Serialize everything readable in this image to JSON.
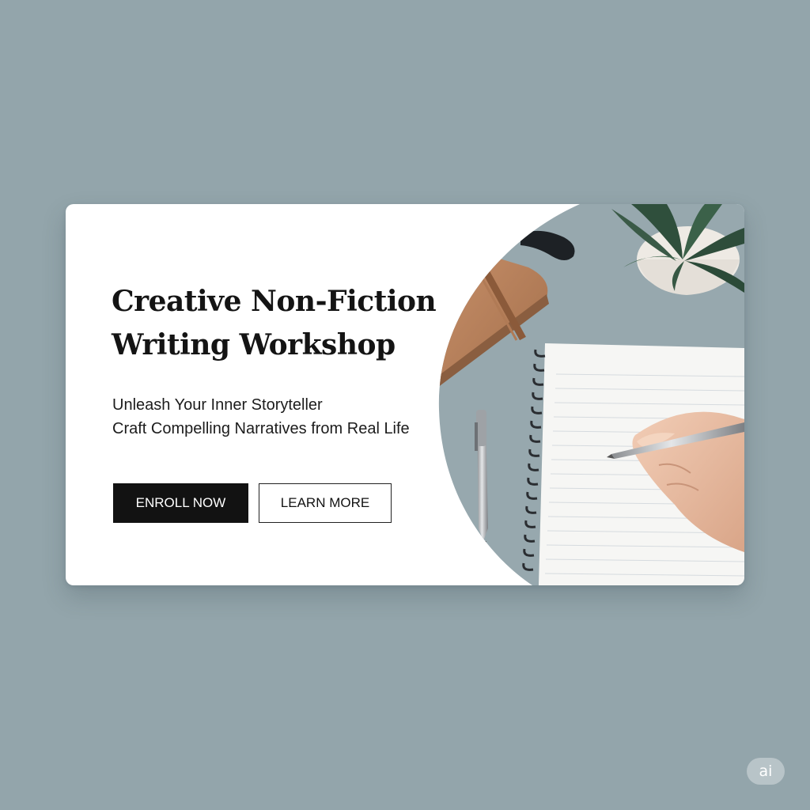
{
  "hero": {
    "title_line1": "Creative Non-Fiction",
    "title_line2": "Writing Workshop",
    "subtitle_line1": "Unleash Your Inner Storyteller",
    "subtitle_line2": "Craft Compelling Narratives from Real Life"
  },
  "actions": {
    "enroll_label": "ENROLL NOW",
    "learn_more_label": "LEARN MORE"
  },
  "photo": {
    "icons": [
      "notebook-icon",
      "pen-icon",
      "plant-icon",
      "hand-icon",
      "journal-icon"
    ]
  },
  "watermark": {
    "label": "ai"
  },
  "colors": {
    "page_background": "#93a5ab",
    "card_background": "#ffffff",
    "primary_button": "#121212",
    "photo_background": "#97a8ae"
  }
}
